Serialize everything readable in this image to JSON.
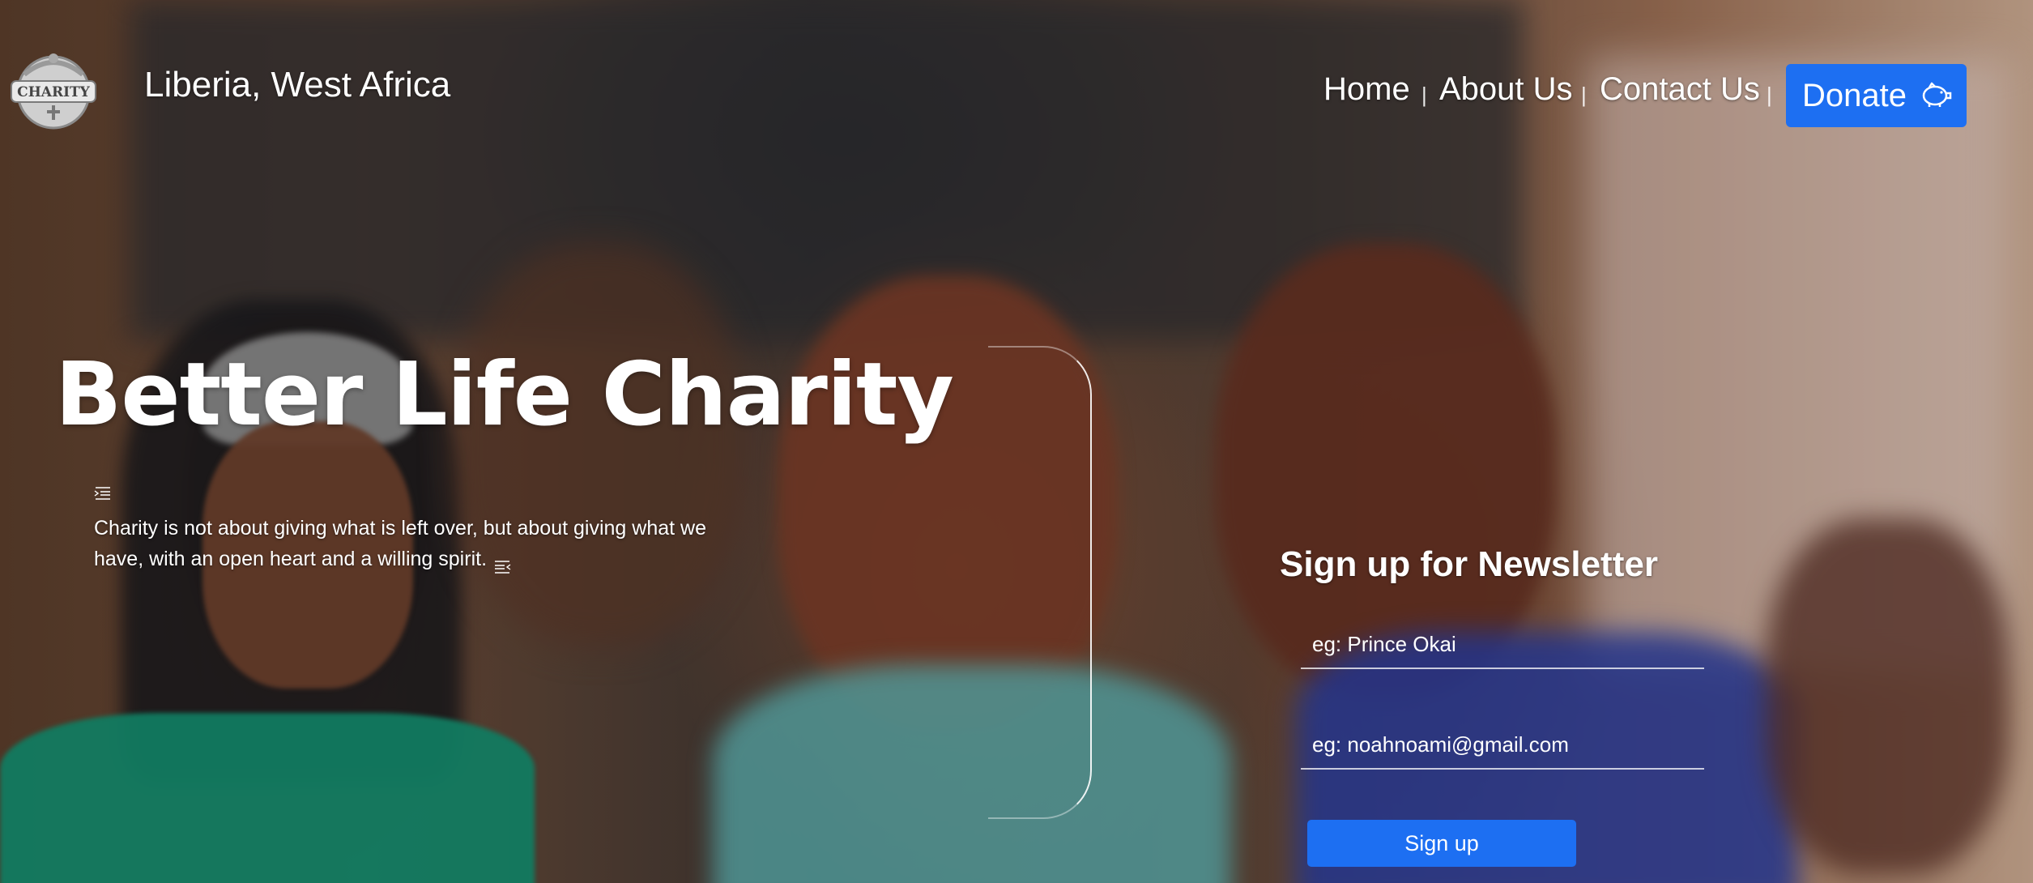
{
  "header": {
    "location": "Liberia, West Africa",
    "logo_text": "CHARITY"
  },
  "nav": {
    "items": [
      {
        "label": "Home"
      },
      {
        "label": "About Us"
      },
      {
        "label": "Contact Us"
      }
    ],
    "separator": "|",
    "donate_label": "Donate"
  },
  "hero": {
    "title": "Better Life Charity",
    "quote": "Charity is not about giving what is left over, but about giving what we have, with an open heart and a willing spirit."
  },
  "newsletter": {
    "title": "Sign up for Newsletter",
    "name_placeholder": "eg: Prince Okai",
    "email_placeholder": "eg: noahnoami@gmail.com",
    "button_label": "Sign up"
  },
  "colors": {
    "accent": "#1d6ff2",
    "text": "#ffffff"
  },
  "icons": {
    "donate": "piggy-bank-icon",
    "quote_open": "text-indent-icon",
    "quote_close": "text-outdent-icon"
  }
}
